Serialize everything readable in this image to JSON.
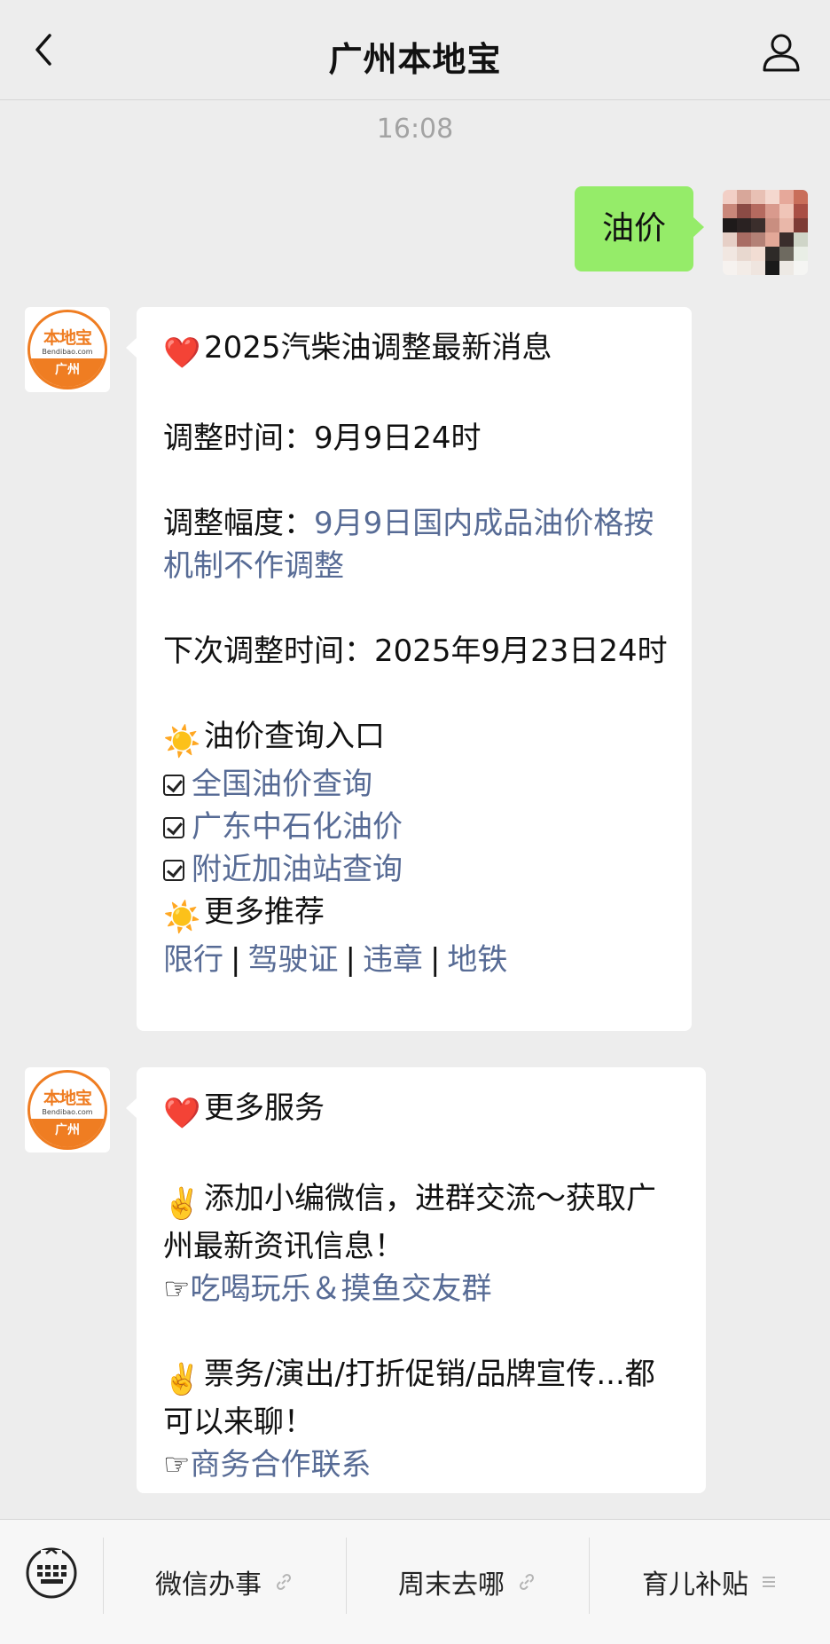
{
  "nav": {
    "title": "广州本地宝"
  },
  "timestamp": "16:08",
  "user_message": {
    "text": "油价"
  },
  "bot_avatar": {
    "logo_text": "本地宝",
    "logo_sub": "Bendibao.com",
    "logo_city": "广州"
  },
  "message1": {
    "heading_emoji": "❤️",
    "heading": "2025汽柴油调整最新消息",
    "adjust_time_label": "调整时间：",
    "adjust_time_value": "9月9日24时",
    "adjust_range_label": "调整幅度：",
    "adjust_range_link": "9月9日国内成品油价格按机制不作调整",
    "next_adjust": "下次调整时间：2025年9月23日24时",
    "query_emoji": "☀️",
    "query_heading": "油价查询入口",
    "query_links": [
      "全国油价查询",
      "广东中石化油价",
      "附近加油站查询"
    ],
    "more_emoji": "☀️",
    "more_heading": "更多推荐",
    "more_links": [
      "限行",
      "驾驶证",
      "违章",
      "地铁"
    ],
    "separator": "|"
  },
  "message2": {
    "heading_emoji": "❤️",
    "heading": "更多服务",
    "para1_emoji": "✌️",
    "para1": "添加小编微信，进群交流～获取广州最新资讯信息！",
    "point_emoji": "☞",
    "link1": "吃喝玩乐＆摸鱼交友群",
    "para2_emoji": "✌️",
    "para2": "票务/演出/打折促销/品牌宣传...都可以来聊！",
    "link2": "商务合作联系"
  },
  "bottom_menu": {
    "items": [
      {
        "label": "微信办事",
        "icon": "link-icon"
      },
      {
        "label": "周末去哪",
        "icon": "link-icon"
      },
      {
        "label": "育儿补贴",
        "icon": "menu-icon"
      }
    ]
  },
  "colors": {
    "bubble_out": "#95ec69",
    "link": "#576b95",
    "background": "#ededed",
    "brand": "#ef7d22"
  }
}
